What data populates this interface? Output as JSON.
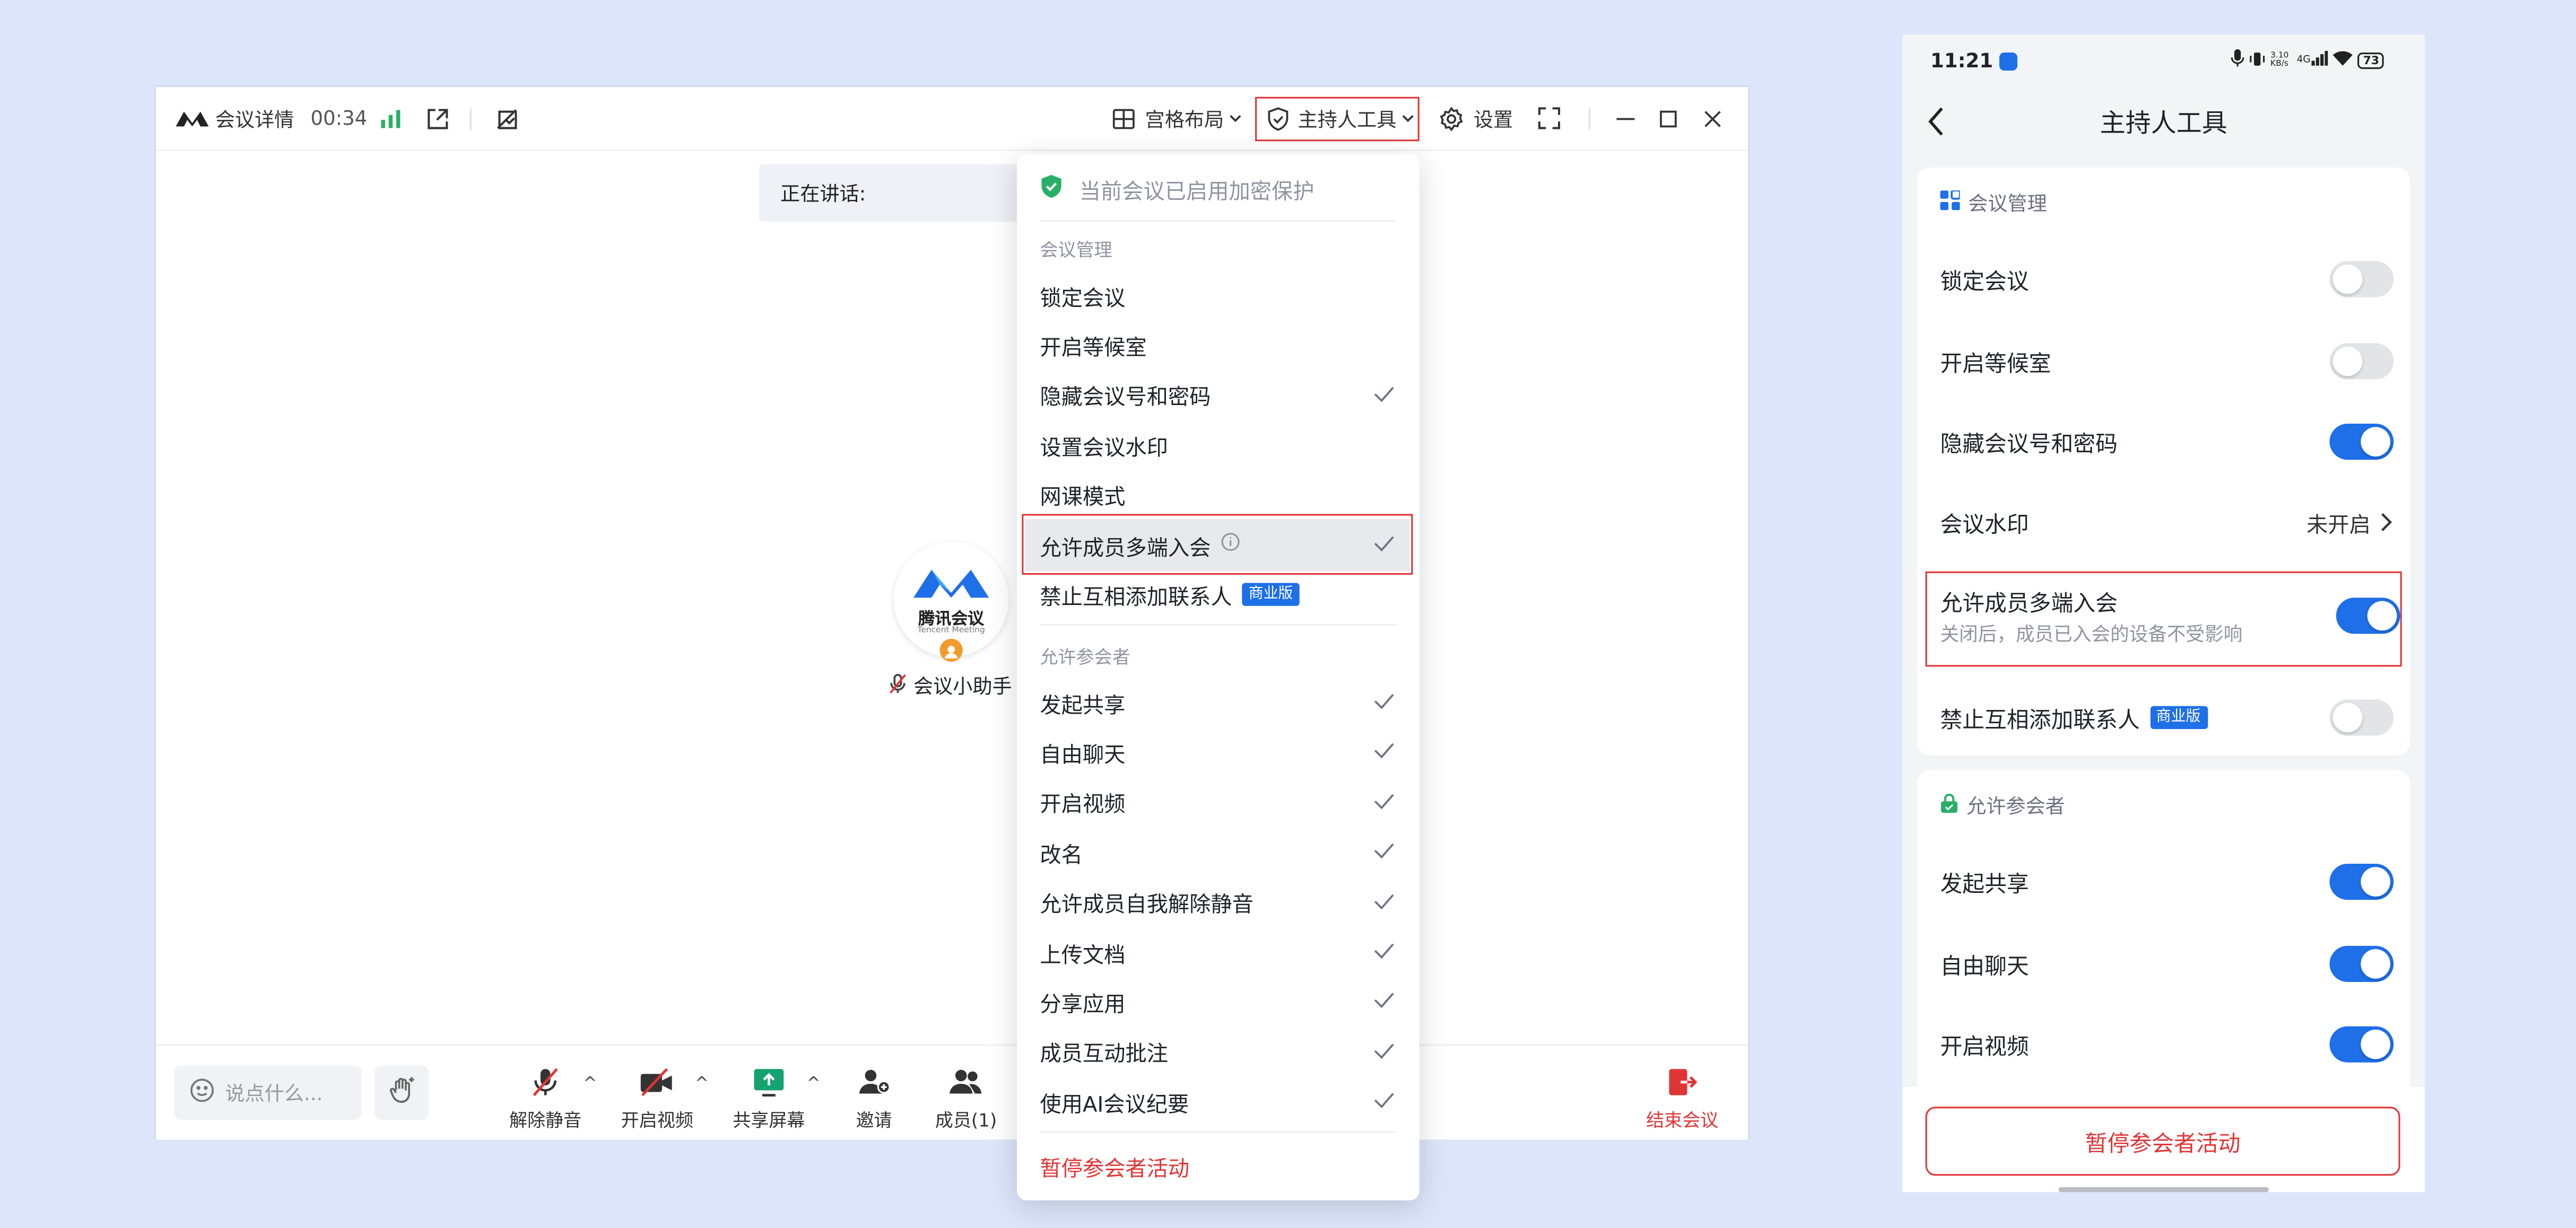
{
  "colors": {
    "accent": "#1e6fe8",
    "danger": "#e03535",
    "background": "#dde5fb",
    "encryption_green": "#27b065"
  },
  "desktop": {
    "meeting_details": "会议详情",
    "timer": "00:34",
    "layout_label": "宫格布局",
    "host_tools_label": "主持人工具",
    "settings_label": "设置",
    "speaking_label": "正在讲话:",
    "participant": {
      "logo_text_cn": "腾讯会议",
      "logo_text_en": "Tencent Meeting",
      "name": "会议小助手"
    },
    "bottom": {
      "chat_placeholder": "说点什么...",
      "unmute": "解除静音",
      "start_video": "开启视频",
      "share_screen": "共享屏幕",
      "invite": "邀请",
      "members": "成员(1)",
      "end_meeting": "结束会议"
    },
    "menu": {
      "encryption_notice": "当前会议已启用加密保护",
      "section_management": "会议管理",
      "management_items": [
        {
          "label": "锁定会议",
          "checked": false
        },
        {
          "label": "开启等候室",
          "checked": false
        },
        {
          "label": "隐藏会议号和密码",
          "checked": true
        },
        {
          "label": "设置会议水印",
          "checked": false
        },
        {
          "label": "网课模式",
          "checked": false
        },
        {
          "label": "允许成员多端入会",
          "checked": true,
          "highlighted": true
        },
        {
          "label": "禁止互相添加联系人",
          "checked": false,
          "badge": "商业版"
        }
      ],
      "section_allow": "允许参会者",
      "allow_items": [
        {
          "label": "发起共享",
          "checked": true
        },
        {
          "label": "自由聊天",
          "checked": true
        },
        {
          "label": "开启视频",
          "checked": true
        },
        {
          "label": "改名",
          "checked": true
        },
        {
          "label": "允许成员自我解除静音",
          "checked": true
        },
        {
          "label": "上传文档",
          "checked": true
        },
        {
          "label": "分享应用",
          "checked": true
        },
        {
          "label": "成员互动批注",
          "checked": true
        },
        {
          "label": "使用AI会议纪要",
          "checked": true
        }
      ],
      "pause_label": "暂停参会者活动"
    }
  },
  "mobile": {
    "status": {
      "time": "11:21",
      "net_speed": "3.10 KB/s",
      "network": "4G",
      "battery": "73"
    },
    "title": "主持人工具",
    "section_management": "会议管理",
    "management_rows": [
      {
        "label": "锁定会议",
        "on": false
      },
      {
        "label": "开启等候室",
        "on": false
      },
      {
        "label": "隐藏会议号和密码",
        "on": true
      }
    ],
    "watermark": {
      "label": "会议水印",
      "value": "未开启"
    },
    "multi_device": {
      "label": "允许成员多端入会",
      "sub": "关闭后，成员已入会的设备不受影响",
      "on": true
    },
    "no_contacts": {
      "label": "禁止互相添加联系人",
      "badge": "商业版",
      "on": false
    },
    "section_allow": "允许参会者",
    "allow_rows": [
      {
        "label": "发起共享",
        "on": true
      },
      {
        "label": "自由聊天",
        "on": true
      },
      {
        "label": "开启视频",
        "on": true
      }
    ],
    "pause_button": "暂停参会者活动"
  }
}
